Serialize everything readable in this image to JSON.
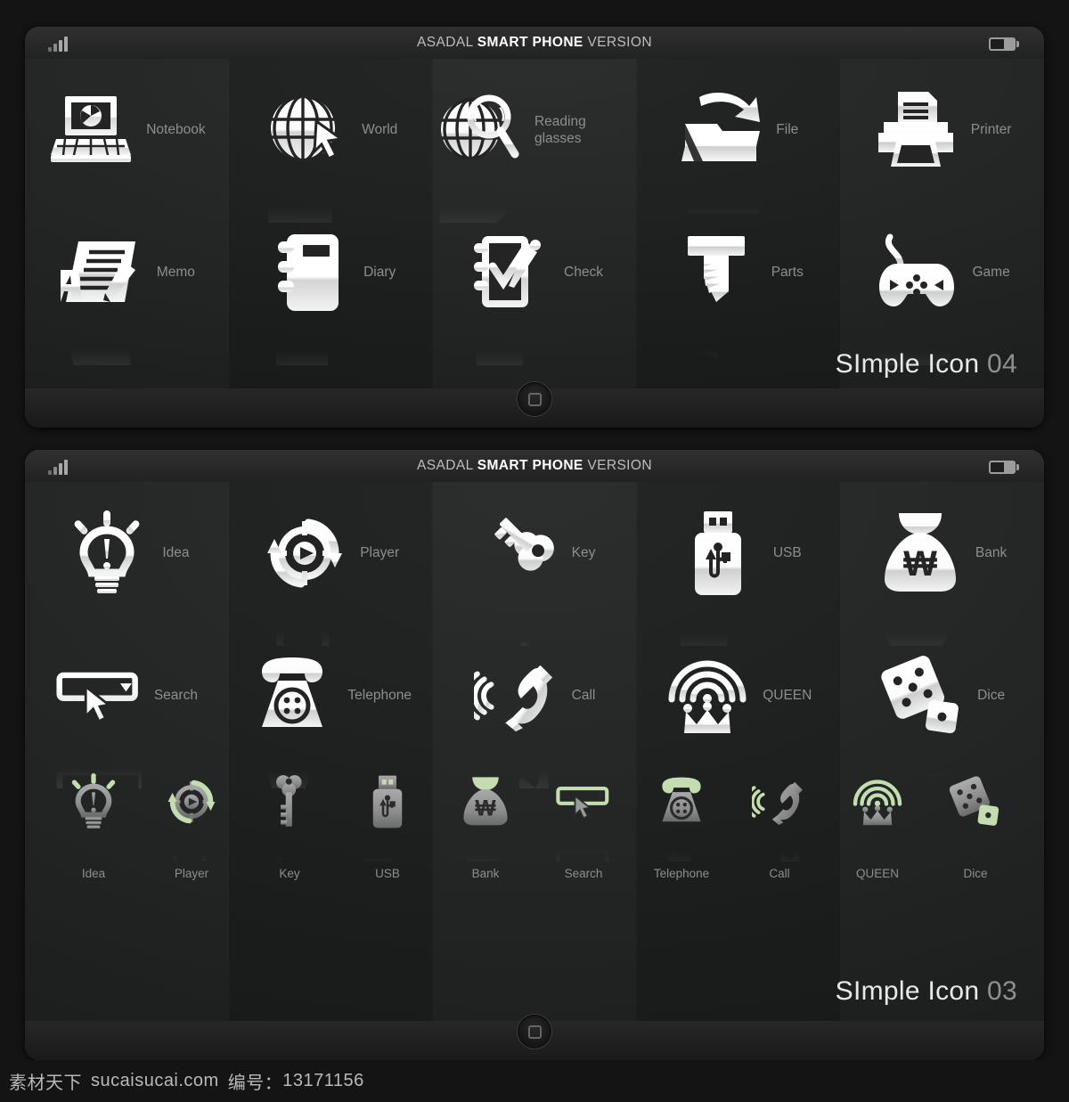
{
  "statusbar": {
    "title_prefix": "ASADAL ",
    "title_strong": "SMART PHONE",
    "title_suffix": " VERSION",
    "signal_icon": "signal-bars-icon",
    "battery_icon": "battery-icon"
  },
  "panel1": {
    "brand_text": "SImple Icon ",
    "brand_num": "04",
    "home_icon": "home-button-icon",
    "icons": [
      {
        "label": "Notebook",
        "icon": "notebook-icon"
      },
      {
        "label": "World",
        "icon": "world-globe-cursor-icon"
      },
      {
        "label": "Reading glasses",
        "icon": "globe-magnifier-icon"
      },
      {
        "label": "File",
        "icon": "folder-upload-icon"
      },
      {
        "label": "Printer",
        "icon": "printer-icon"
      },
      {
        "label": "Memo",
        "icon": "memo-pencil-icon"
      },
      {
        "label": "Diary",
        "icon": "diary-notebook-icon"
      },
      {
        "label": "Check",
        "icon": "check-clipboard-icon"
      },
      {
        "label": "Parts",
        "icon": "screw-bolt-icon"
      },
      {
        "label": "Game",
        "icon": "gamepad-icon"
      }
    ]
  },
  "panel2": {
    "brand_text": "SImple Icon ",
    "brand_num": "03",
    "home_icon": "home-button-icon",
    "icons": [
      {
        "label": "Idea",
        "icon": "lightbulb-icon"
      },
      {
        "label": "Player",
        "icon": "player-refresh-icon"
      },
      {
        "label": "Key",
        "icon": "key-icon"
      },
      {
        "label": "USB",
        "icon": "usb-drive-icon"
      },
      {
        "label": "Bank",
        "icon": "money-bag-won-icon"
      },
      {
        "label": "Search",
        "icon": "search-dropdown-cursor-icon"
      },
      {
        "label": "Telephone",
        "icon": "rotary-telephone-icon"
      },
      {
        "label": "Call",
        "icon": "call-handset-waves-icon"
      },
      {
        "label": "QUEEN",
        "icon": "crown-waves-icon"
      },
      {
        "label": "Dice",
        "icon": "dice-icon"
      }
    ],
    "small_icons": [
      {
        "label": "Idea",
        "icon": "lightbulb-icon"
      },
      {
        "label": "Player",
        "icon": "player-refresh-icon"
      },
      {
        "label": "Key",
        "icon": "key-icon"
      },
      {
        "label": "USB",
        "icon": "usb-drive-icon"
      },
      {
        "label": "Bank",
        "icon": "money-bag-won-icon"
      },
      {
        "label": "Search",
        "icon": "search-dropdown-cursor-icon"
      },
      {
        "label": "Telephone",
        "icon": "rotary-telephone-icon"
      },
      {
        "label": "Call",
        "icon": "call-handset-waves-icon"
      },
      {
        "label": "QUEEN",
        "icon": "crown-waves-icon"
      },
      {
        "label": "Dice",
        "icon": "dice-icon"
      }
    ]
  },
  "footer": {
    "site_cn": "素材天下",
    "site_url": "sucaisucai.com",
    "code_label": "编号：",
    "code_value": "13171156"
  },
  "colors": {
    "accent_green": "#c3dcb0",
    "icon_white": "#f2f2f2",
    "icon_gray": "#9a9a9a",
    "label_gray": "#8d8d8d",
    "screen_bg": "#202222"
  }
}
